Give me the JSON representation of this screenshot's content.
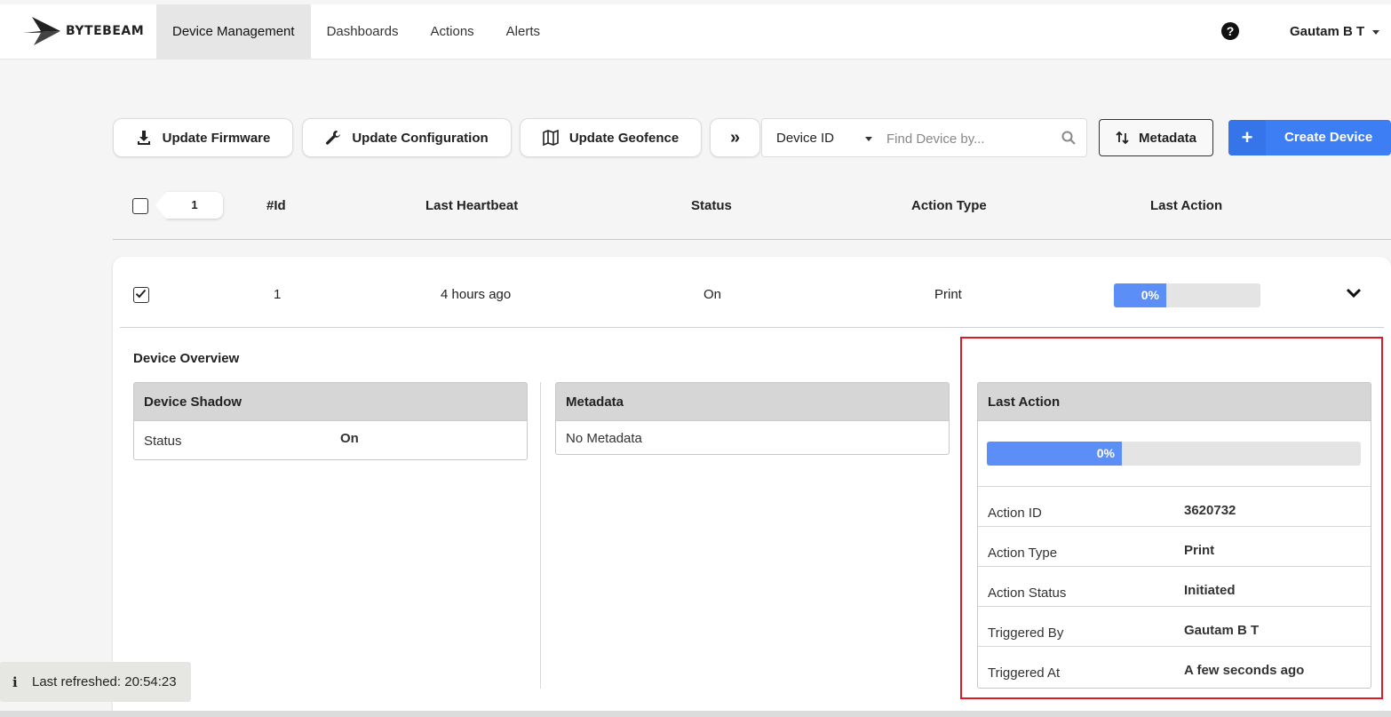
{
  "brand": {
    "name": "BYTEBEAM"
  },
  "nav": {
    "items": [
      {
        "label": "Device Management",
        "active": true
      },
      {
        "label": "Dashboards"
      },
      {
        "label": "Actions"
      },
      {
        "label": "Alerts"
      }
    ],
    "help_glyph": "?",
    "user": "Gautam B T"
  },
  "toolbar": {
    "update_firmware": "Update Firmware",
    "update_configuration": "Update Configuration",
    "update_geofence": "Update Geofence",
    "more_glyph": "»",
    "search_by": "Device ID",
    "search_placeholder": "Find Device by...",
    "metadata": "Metadata",
    "create_plus": "+",
    "create_device": "Create Device"
  },
  "table": {
    "selected_count": "1",
    "headers": {
      "id": "#Id",
      "heartbeat": "Last Heartbeat",
      "status": "Status",
      "action_type": "Action Type",
      "last_action": "Last Action"
    },
    "row": {
      "id": "1",
      "heartbeat": "4 hours ago",
      "status": "On",
      "action_type": "Print",
      "progress_label": "0%",
      "progress_fraction": 0.0,
      "checked": true
    }
  },
  "overview": {
    "title": "Device Overview",
    "shadow": {
      "title": "Device Shadow",
      "status_key": "Status",
      "status_value": "On"
    },
    "metadata": {
      "title": "Metadata",
      "empty": "No Metadata"
    },
    "last_action": {
      "title": "Last Action",
      "progress_label": "0%",
      "progress_fraction": 0.0,
      "fields": [
        {
          "key": "Action ID",
          "value": "3620732"
        },
        {
          "key": "Action Type",
          "value": "Print"
        },
        {
          "key": "Action Status",
          "value": "Initiated"
        },
        {
          "key": "Triggered By",
          "value": "Gautam B T"
        },
        {
          "key": "Triggered At",
          "value": "A few seconds ago"
        }
      ]
    }
  },
  "toast": {
    "text": "Last refreshed: 20:54:23",
    "icon": "info-icon"
  },
  "colors": {
    "accent": "#3e7ef5",
    "progress": "#5b8ef7",
    "highlight": "#e0191f"
  }
}
